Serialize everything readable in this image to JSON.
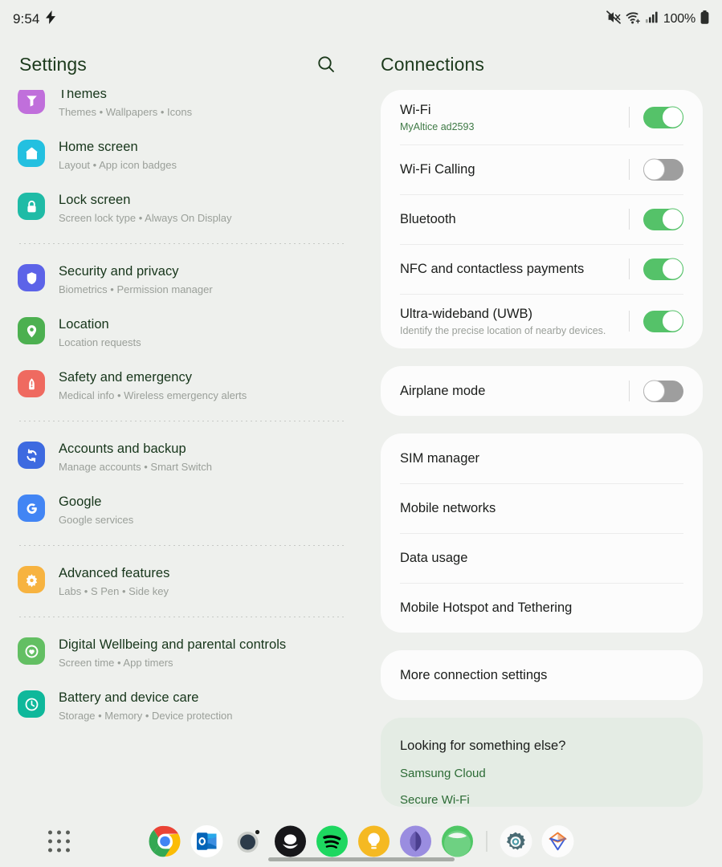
{
  "statusbar": {
    "time": "9:54",
    "battery_text": "100%",
    "icons": [
      "charging-bolt-icon",
      "mute-icon",
      "wifi-icon",
      "signal-icon",
      "battery-icon"
    ]
  },
  "left": {
    "title": "Settings",
    "search_icon": "search-icon",
    "groups": [
      {
        "items": [
          {
            "title": "Themes",
            "sub": "Themes  •  Wallpapers  •  Icons",
            "icon": "themes-icon",
            "color": "#c06fdb"
          },
          {
            "title": "Home screen",
            "sub": "Layout  •  App icon badges",
            "icon": "home-screen-icon",
            "color": "#23c0e0"
          },
          {
            "title": "Lock screen",
            "sub": "Screen lock type  •  Always On Display",
            "icon": "lock-icon",
            "color": "#1fbba6"
          }
        ]
      },
      {
        "items": [
          {
            "title": "Security and privacy",
            "sub": "Biometrics  •  Permission manager",
            "icon": "shield-icon",
            "color": "#5c63e8"
          },
          {
            "title": "Location",
            "sub": "Location requests",
            "icon": "location-pin-icon",
            "color": "#4cb050"
          },
          {
            "title": "Safety and emergency",
            "sub": "Medical info  •  Wireless emergency alerts",
            "icon": "emergency-icon",
            "color": "#ef6a60"
          }
        ]
      },
      {
        "items": [
          {
            "title": "Accounts and backup",
            "sub": "Manage accounts  •  Smart Switch",
            "icon": "sync-icon",
            "color": "#3d6ae0"
          },
          {
            "title": "Google",
            "sub": "Google services",
            "icon": "google-icon",
            "color": "#4285f4"
          }
        ]
      },
      {
        "items": [
          {
            "title": "Advanced features",
            "sub": "Labs  •  S Pen  •  Side key",
            "icon": "advanced-features-icon",
            "color": "#f7b340"
          }
        ]
      },
      {
        "items": [
          {
            "title": "Digital Wellbeing and parental controls",
            "sub": "Screen time  •  App timers",
            "icon": "digital-wellbeing-icon",
            "color": "#63bf63"
          },
          {
            "title": "Battery and device care",
            "sub": "Storage  •  Memory  •  Device protection",
            "icon": "device-care-icon",
            "color": "#0fb89b"
          }
        ]
      }
    ]
  },
  "right": {
    "title": "Connections",
    "cards": [
      {
        "type": "toggles",
        "rows": [
          {
            "label": "Wi-Fi",
            "sub": "MyAltice ad2593",
            "sub_green": true,
            "toggle": "on"
          },
          {
            "label": "Wi-Fi Calling",
            "sub": "",
            "toggle": "off"
          },
          {
            "label": "Bluetooth",
            "sub": "",
            "toggle": "on"
          },
          {
            "label": "NFC and contactless payments",
            "sub": "",
            "toggle": "on"
          },
          {
            "label": "Ultra-wideband (UWB)",
            "sub": "Identify the precise location of nearby devices.",
            "toggle": "on"
          }
        ]
      },
      {
        "type": "toggles",
        "rows": [
          {
            "label": "Airplane mode",
            "sub": "",
            "toggle": "off"
          }
        ]
      },
      {
        "type": "links",
        "rows": [
          {
            "label": "SIM manager"
          },
          {
            "label": "Mobile networks"
          },
          {
            "label": "Data usage"
          },
          {
            "label": "Mobile Hotspot and Tethering"
          }
        ]
      },
      {
        "type": "links",
        "rows": [
          {
            "label": "More connection settings"
          }
        ]
      }
    ],
    "looking_for": {
      "title": "Looking for something else?",
      "links": [
        "Samsung Cloud",
        "Secure Wi-Fi"
      ]
    }
  },
  "taskbar": {
    "app_grid_icon": "app-grid-icon",
    "apps": [
      {
        "name": "chrome-icon"
      },
      {
        "name": "outlook-icon"
      },
      {
        "name": "dark-circle-app-icon"
      },
      {
        "name": "smartthings-icon"
      },
      {
        "name": "spotify-icon"
      },
      {
        "name": "bixby-bulb-icon"
      },
      {
        "name": "purple-app-icon"
      },
      {
        "name": "green-app-icon"
      }
    ],
    "recent": [
      {
        "name": "settings-gear-icon"
      },
      {
        "name": "diamond-app-icon"
      }
    ],
    "home_indicator": "home-indicator"
  },
  "colors": {
    "background": "#eef0ed",
    "card": "#fcfcfc",
    "accent_green": "#55c269",
    "title_green": "#1c3a1c",
    "link_green": "#2c6b35",
    "toggle_off": "#9e9e9e"
  }
}
